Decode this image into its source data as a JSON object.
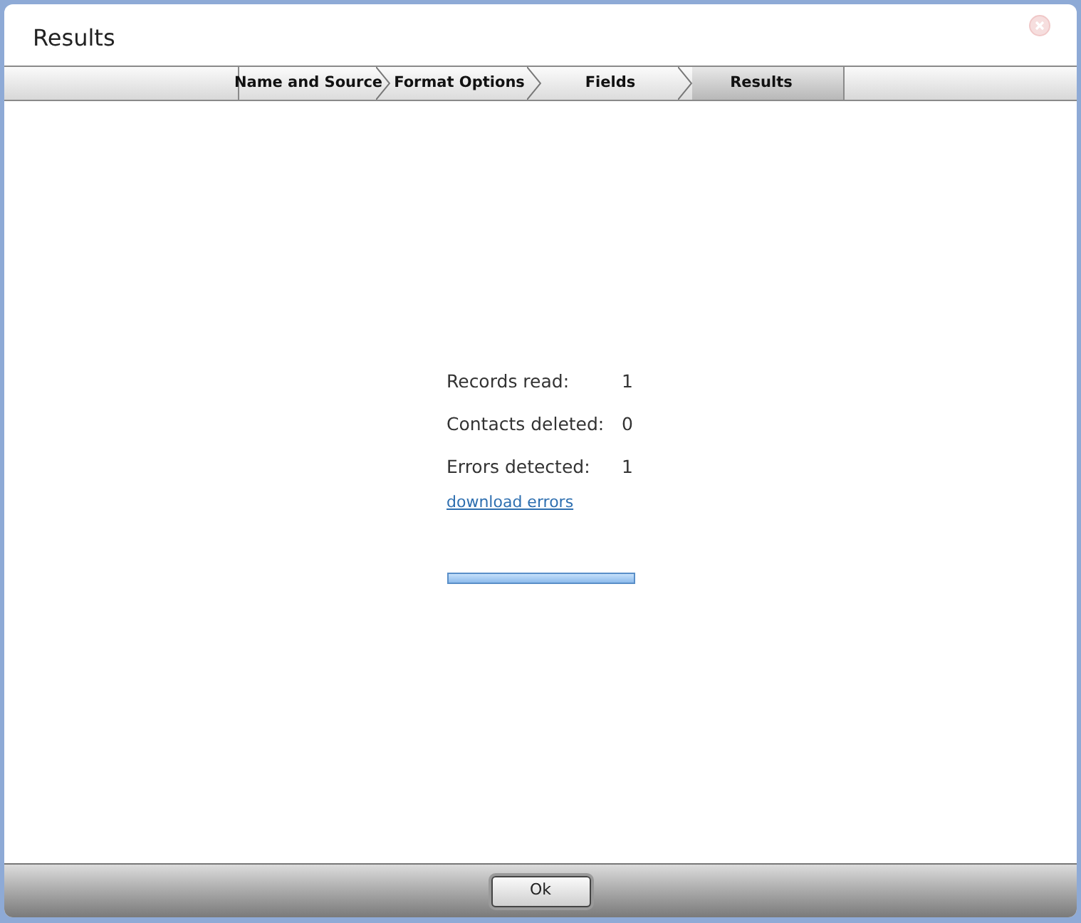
{
  "window": {
    "title": "Results"
  },
  "steps": [
    {
      "label": "Name and Source",
      "selected": false
    },
    {
      "label": "Format Options",
      "selected": false
    },
    {
      "label": "Fields",
      "selected": false
    },
    {
      "label": "Results",
      "selected": true
    }
  ],
  "stats": [
    {
      "label": "Records read:",
      "value": "1"
    },
    {
      "label": "Contacts deleted:",
      "value": "0"
    },
    {
      "label": "Errors detected:",
      "value": "1"
    }
  ],
  "link": "download errors",
  "progress": {
    "level": 1
  },
  "buttons": [
    "Ok"
  ]
}
